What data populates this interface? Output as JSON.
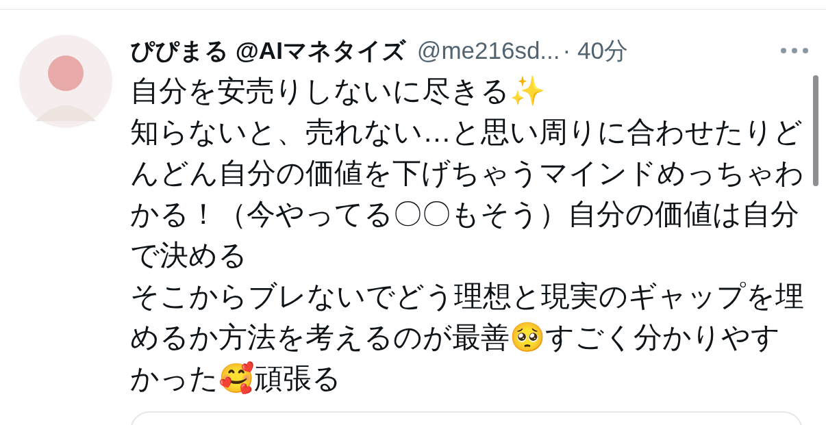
{
  "tweet": {
    "display_name": "ぴぴまる @AIマネタイズ",
    "handle": "@me216sd...",
    "time": "· 40分",
    "paragraphs": [
      "自分を安売りしないに尽きる✨",
      "知らないと、売れない…と思い周りに合わせたりどんどん自分の価値を下げちゃうマインドめっちゃわかる！（今やってる〇〇もそう）自分の価値は自分で決める",
      "そこからブレないでどう理想と現実のギャップを埋めるか方法を考えるのが最善🥺すごく分かりやすかった🥰頑張る"
    ]
  }
}
